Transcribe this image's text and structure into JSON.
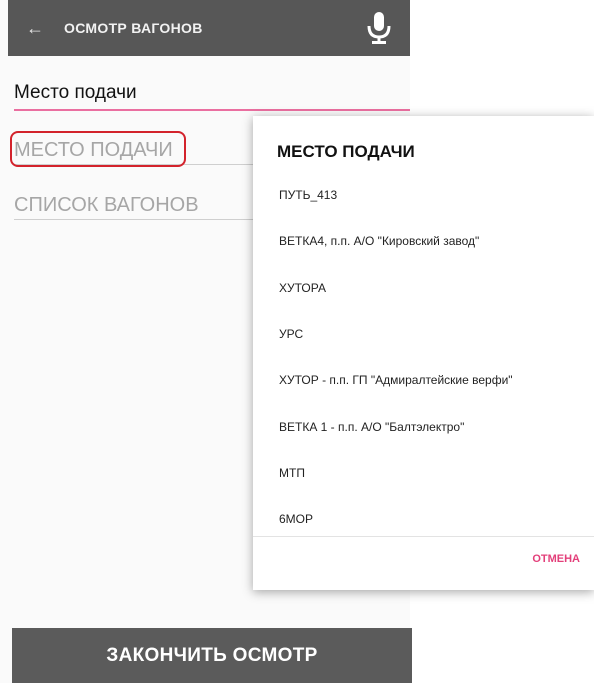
{
  "header": {
    "title": "ОСМОТР ВАГОНОВ",
    "back_icon": "arrow-left-icon",
    "mic_icon": "microphone-icon"
  },
  "form": {
    "field_label": "Место подачи",
    "place_field": "МЕСТО ПОДАЧИ",
    "wagon_list_field": "СПИСОК ВАГОНОВ"
  },
  "dialog": {
    "title": "МЕСТО ПОДАЧИ",
    "options": [
      "ПУТЬ_413",
      "ВЕТКА4, п.п. А/О \"Кировский завод\"",
      "ХУТОРА",
      "УРС",
      "ХУТОР - п.п. ГП \"Адмиралтейские верфи\"",
      "ВЕТКА 1 - п.п. А/О \"Балтэлектро\"",
      "МТП",
      "6МОР"
    ],
    "cancel_label": "ОТМЕНА"
  },
  "footer": {
    "finish_label": "ЗАКОНЧИТЬ ОСМОТР"
  },
  "colors": {
    "toolbar": "#575757",
    "accent_pink": "#e33f7a",
    "highlight_red": "#d3232c",
    "footer_button": "#5b5b5b"
  }
}
